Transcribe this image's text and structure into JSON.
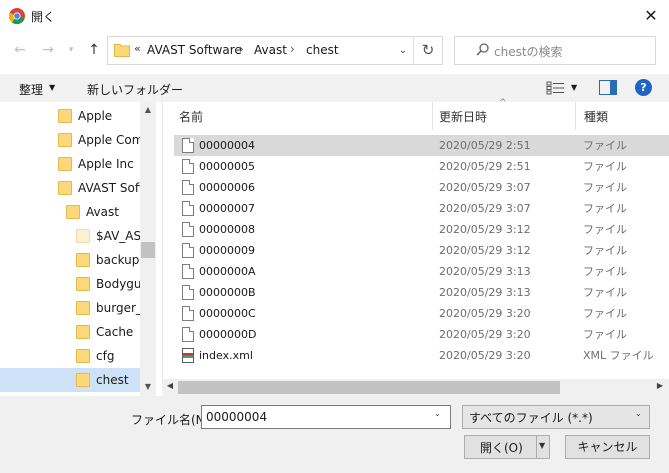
{
  "window": {
    "title": "開く",
    "close_glyph": "✕"
  },
  "nav": {
    "back_glyph": "←",
    "forward_glyph": "→",
    "recent_glyph": "▾",
    "up_glyph": "↑",
    "breadcrumb_prefix": "«",
    "breadcrumbs": [
      "AVAST Software",
      "Avast",
      "chest"
    ],
    "separator": "›",
    "dropdown_glyph": "⌄",
    "refresh_glyph": "↻",
    "search_placeholder": "chestの検索"
  },
  "toolbar": {
    "organize_label": "整理",
    "dropdown_glyph": "▼",
    "new_folder_label": "新しいフォルダー",
    "help_glyph": "?"
  },
  "tree": {
    "items": [
      {
        "label": "Apple",
        "level": 0,
        "light": false
      },
      {
        "label": "Apple Comp",
        "level": 0,
        "light": false
      },
      {
        "label": "Apple Inc",
        "level": 0,
        "light": false
      },
      {
        "label": "AVAST Softv",
        "level": 0,
        "light": false
      },
      {
        "label": "Avast",
        "level": 1,
        "light": false
      },
      {
        "label": "$AV_ASV",
        "level": 2,
        "light": true
      },
      {
        "label": "backup",
        "level": 2,
        "light": false
      },
      {
        "label": "Bodygua",
        "level": 2,
        "light": false
      },
      {
        "label": "burger_c",
        "level": 2,
        "light": false
      },
      {
        "label": "Cache",
        "level": 2,
        "light": false
      },
      {
        "label": "cfg",
        "level": 2,
        "light": false
      },
      {
        "label": "chest",
        "level": 2,
        "light": false
      }
    ],
    "selected_label": "chest",
    "scroll_up_glyph": "▲",
    "scroll_down_glyph": "▼"
  },
  "filelist": {
    "columns": [
      "名前",
      "更新日時",
      "種類"
    ],
    "sort_glyph": "^",
    "rows": [
      {
        "name": "00000004",
        "date": "2020/05/29 2:51",
        "type": "ファイル",
        "icon": "doc",
        "selected": true
      },
      {
        "name": "00000005",
        "date": "2020/05/29 2:51",
        "type": "ファイル",
        "icon": "doc",
        "selected": false
      },
      {
        "name": "00000006",
        "date": "2020/05/29 3:07",
        "type": "ファイル",
        "icon": "doc",
        "selected": false
      },
      {
        "name": "00000007",
        "date": "2020/05/29 3:07",
        "type": "ファイル",
        "icon": "doc",
        "selected": false
      },
      {
        "name": "00000008",
        "date": "2020/05/29 3:12",
        "type": "ファイル",
        "icon": "doc",
        "selected": false
      },
      {
        "name": "00000009",
        "date": "2020/05/29 3:12",
        "type": "ファイル",
        "icon": "doc",
        "selected": false
      },
      {
        "name": "0000000A",
        "date": "2020/05/29 3:13",
        "type": "ファイル",
        "icon": "doc",
        "selected": false
      },
      {
        "name": "0000000B",
        "date": "2020/05/29 3:13",
        "type": "ファイル",
        "icon": "doc",
        "selected": false
      },
      {
        "name": "0000000C",
        "date": "2020/05/29 3:20",
        "type": "ファイル",
        "icon": "doc",
        "selected": false
      },
      {
        "name": "0000000D",
        "date": "2020/05/29 3:20",
        "type": "ファイル",
        "icon": "doc",
        "selected": false
      },
      {
        "name": "index.xml",
        "date": "2020/05/29 3:20",
        "type": "XML ファイル",
        "icon": "xml",
        "selected": false
      }
    ],
    "scroll_left_glyph": "◀",
    "scroll_right_glyph": "▶"
  },
  "footer": {
    "filename_label": "ファイル名(N):",
    "filename_value": "00000004",
    "dropdown_glyph": "⌄",
    "filetype_value": "すべてのファイル (*.*)",
    "open_label": "開く(O)",
    "open_arrow_glyph": "▼",
    "cancel_label": "キャンセル"
  },
  "colors": {
    "selection_row": "#d9d9d9",
    "selection_tree": "#cde1f7",
    "folder": "#fcd87a",
    "help_blue": "#1e64c8"
  },
  "icons": [
    "chrome-icon",
    "back-arrow-icon",
    "forward-arrow-icon",
    "up-arrow-icon",
    "folder-icon",
    "refresh-icon",
    "search-icon",
    "view-menu-icon",
    "preview-pane-icon",
    "help-icon",
    "document-icon",
    "xml-file-icon"
  ]
}
